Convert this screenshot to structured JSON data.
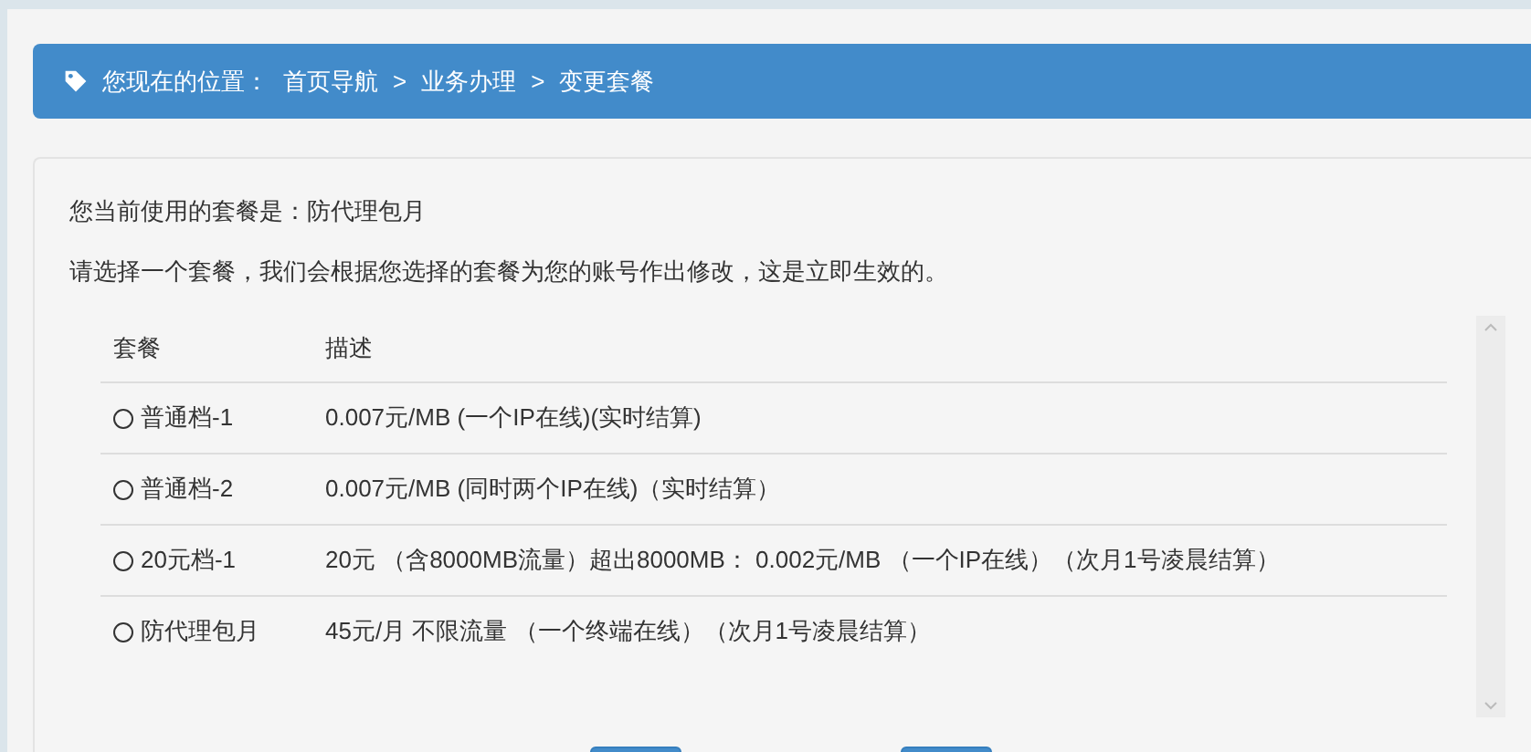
{
  "breadcrumb": {
    "label": "您现在的位置：",
    "items": [
      "首页导航",
      "业务办理",
      "变更套餐"
    ],
    "separators": [
      ">",
      ">"
    ]
  },
  "current_plan": "您当前使用的套餐是：防代理包月",
  "instruction": "请选择一个套餐，我们会根据您选择的套餐为您的账号作出修改，这是立即生效的。",
  "table": {
    "columns": [
      "套餐",
      "描述"
    ],
    "rows": [
      {
        "name": "普通档-1",
        "description": "0.007元/MB (一个IP在线)(实时结算)",
        "selected": false
      },
      {
        "name": "普通档-2",
        "description": "0.007元/MB (同时两个IP在线)（实时结算）",
        "selected": false
      },
      {
        "name": "20元档-1",
        "description": "20元 （含8000MB流量）超出8000MB： 0.002元/MB （一个IP在线）（次月1号凌晨结算）",
        "selected": false
      },
      {
        "name": "防代理包月",
        "description": "45元/月 不限流量 （一个终端在线）（次月1号凌晨结算）",
        "selected": false
      }
    ]
  },
  "buttons": [
    {
      "kind": "primary"
    },
    {
      "kind": "primary"
    }
  ]
}
